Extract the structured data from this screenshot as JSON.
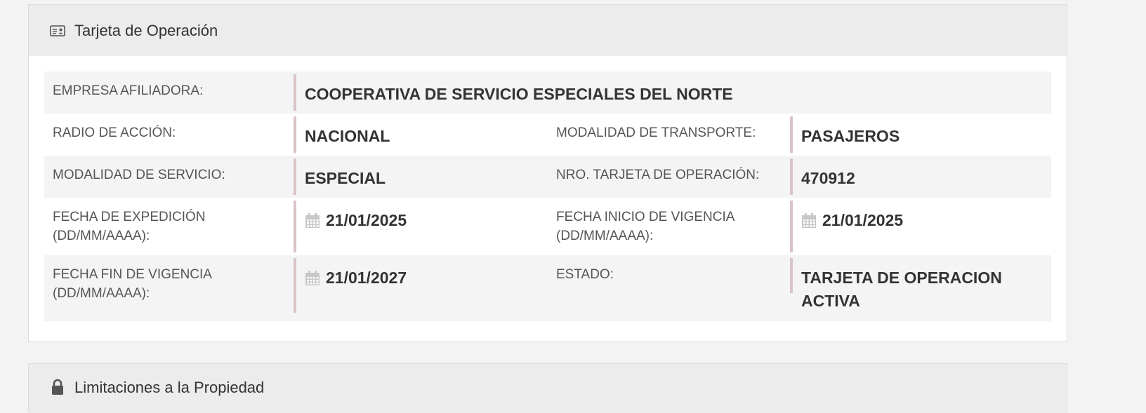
{
  "card_panel": {
    "title": "Tarjeta de Operación",
    "icon": "id-card-icon",
    "rows": {
      "empresa": {
        "label": "EMPRESA AFILIADORA:",
        "value": "COOPERATIVA DE SERVICIO ESPECIALES DEL NORTE"
      },
      "radio": {
        "label": "RADIO DE ACCIÓN:",
        "value": "NACIONAL"
      },
      "modalidad_transporte": {
        "label": "MODALIDAD DE TRANSPORTE:",
        "value": "PASAJEROS"
      },
      "modalidad_servicio": {
        "label": "MODALIDAD DE SERVICIO:",
        "value": "ESPECIAL"
      },
      "nro_tarjeta": {
        "label": "NRO. TARJETA DE OPERACIÓN:",
        "value": "470912"
      },
      "fecha_expedicion": {
        "label_line1": "FECHA DE EXPEDICIÓN",
        "label_line2": "(DD/MM/AAAA):",
        "value": "21/01/2025"
      },
      "fecha_inicio": {
        "label_line1": "FECHA INICIO DE VIGENCIA",
        "label_line2": "(DD/MM/AAAA):",
        "value": "21/01/2025"
      },
      "fecha_fin": {
        "label_line1": "FECHA FIN DE VIGENCIA",
        "label_line2": "(DD/MM/AAAA):",
        "value": "21/01/2027"
      },
      "estado": {
        "label": "ESTADO:",
        "value_line1": "TARJETA DE OPERACION",
        "value_line2": "ACTIVA"
      }
    }
  },
  "limitations_panel": {
    "title": "Limitaciones a la Propiedad",
    "icon": "lock-icon"
  },
  "colors": {
    "value_border": "#d9c4c6",
    "heading_bg": "#ececec",
    "shaded_row": "#f4f4f4",
    "icon_gray": "#c8c8c8"
  }
}
